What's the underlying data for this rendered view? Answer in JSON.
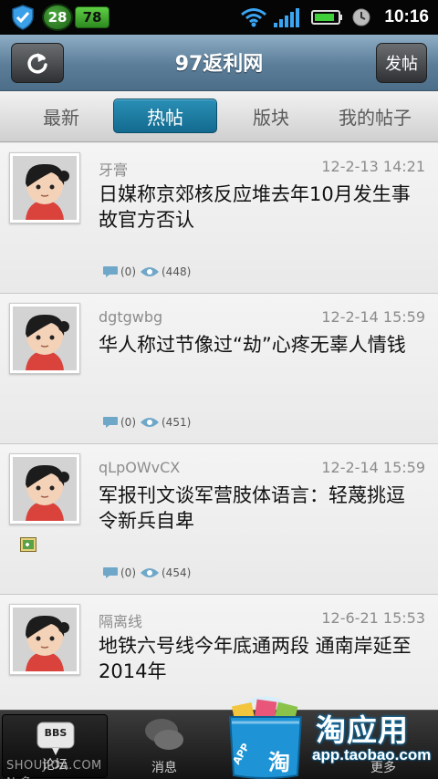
{
  "status_bar": {
    "badge_left": "28",
    "badge_right": "78",
    "time": "10:16",
    "icons": [
      "shield-icon",
      "wifi-icon",
      "signal-icon",
      "battery-icon",
      "alarm-icon"
    ]
  },
  "header": {
    "title": "97返利网",
    "post_button": "发帖",
    "refresh_icon": "refresh-icon"
  },
  "tabs": [
    {
      "label": "最新",
      "active": false
    },
    {
      "label": "热帖",
      "active": true
    },
    {
      "label": "版块",
      "active": false
    },
    {
      "label": "我的帖子",
      "active": false
    }
  ],
  "posts": [
    {
      "author": "牙膏",
      "time": "12-2-13 14:21",
      "title": "日媒称京郊核反应堆去年10月发生事故官方否认",
      "comments": "(0)",
      "views": "(448)",
      "has_attachment": false
    },
    {
      "author": "dgtgwbg",
      "time": "12-2-14 15:59",
      "title": "华人称过节像过“劫”心疼无辜人情钱",
      "comments": "(0)",
      "views": "(451)",
      "has_attachment": false
    },
    {
      "author": "qLpOWvCX",
      "time": "12-2-14 15:59",
      "title": "军报刊文谈军营肢体语言：轻蔑挑逗令新兵自卑",
      "comments": "(0)",
      "views": "(454)",
      "has_attachment": true
    },
    {
      "author": "隔离线",
      "time": "12-6-21 15:53",
      "title": "地铁六号线今年底通两段 通南岸延至2014年",
      "comments": "",
      "views": "",
      "has_attachment": false
    }
  ],
  "bottom_nav": [
    {
      "label": "论坛",
      "icon": "bbs-icon",
      "active": true
    },
    {
      "label": "消息",
      "icon": "message-icon",
      "active": false
    },
    {
      "label": "更多",
      "icon": "more-icon",
      "active": false
    }
  ],
  "bbs_icon_text": "BBS",
  "watermark": "SHOUJIOA.COM N 多",
  "promo": {
    "title": "淘应用",
    "url": "app.taobao.com",
    "bag_label": "APP",
    "bag_char": "淘",
    "brand_color": "#1e94d6"
  },
  "colors": {
    "tab_active": "#1a7aa0",
    "titlebar": "#6a8ca8"
  }
}
